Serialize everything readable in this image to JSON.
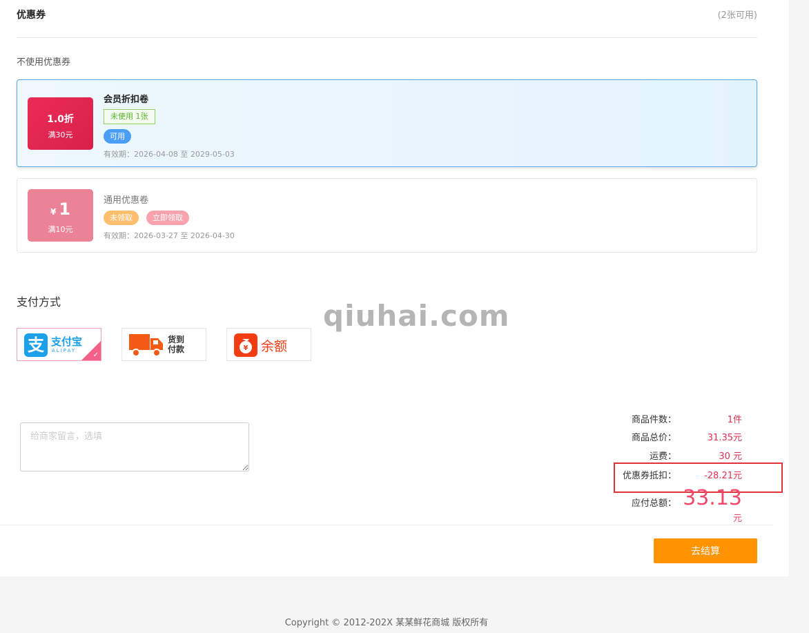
{
  "coupons_section": {
    "title": "优惠券",
    "available_count": "(2张可用)",
    "no_coupon_label": "不使用优惠券",
    "items": [
      {
        "discount": "1.0折",
        "threshold": "满30元",
        "name": "会员折扣卷",
        "status_label": "未使用 1张",
        "action_label": "可用",
        "validity": "有效期：2026-04-08 至 2029-05-03",
        "selected": true
      },
      {
        "currency": "¥",
        "amount": "1",
        "threshold": "满10元",
        "name": "通用优惠卷",
        "status_label": "未领取",
        "action_label": "立即领取",
        "validity": "有效期：2026-03-27 至 2026-04-30",
        "selected": false
      }
    ]
  },
  "payment": {
    "title": "支付方式",
    "methods": [
      {
        "id": "alipay",
        "label": "支付宝",
        "sublabel": "ALIPAY",
        "icon": "alipay-icon",
        "selected": true
      },
      {
        "id": "cod",
        "label": "货到付款",
        "line1": "货到",
        "line2": "付款",
        "icon": "delivery-truck-icon",
        "selected": false
      },
      {
        "id": "balance",
        "label": "余额",
        "icon": "money-bag-icon",
        "selected": false
      }
    ]
  },
  "remark": {
    "placeholder": "给商家留言，选填"
  },
  "summary": {
    "item_count_label": "商品件数：",
    "item_count_value": "1件",
    "goods_total_label": "商品总价：",
    "goods_total_value": "31.35元",
    "shipping_label": "运费：",
    "shipping_value": "30 元",
    "coupon_deduction_label": "优惠券抵扣：",
    "coupon_deduction_value": "-28.21元",
    "payable_label": "应付总额：",
    "payable_amount": "33.13",
    "payable_unit": "元"
  },
  "checkout_button": "去结算",
  "watermark": "qiuhai.com",
  "footer": "Copyright © 2012-202X 某某鲜花商城 版权所有",
  "colors": {
    "accent_orange": "#ff9300",
    "price_red": "#e03055",
    "coupon_red": "#e0264f",
    "coupon_pink": "#ec8296",
    "selected_blue": "#5aa8e6"
  }
}
